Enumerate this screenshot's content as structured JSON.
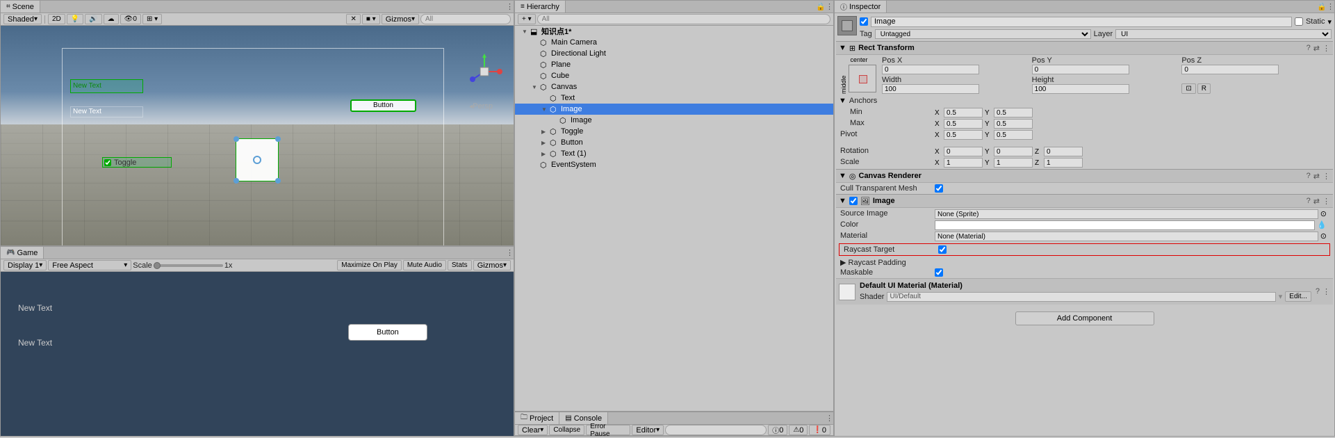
{
  "scene": {
    "tab": "Scene",
    "shading": "Shaded",
    "mode2d": "2D",
    "gizmos": "Gizmos",
    "search_placeholder": "All",
    "persp": "Persp",
    "objects": {
      "new_text1": "New Text",
      "new_text2": "New Text",
      "button": "Button",
      "toggle": "Toggle"
    }
  },
  "game": {
    "tab": "Game",
    "display": "Display 1",
    "aspect": "Free Aspect",
    "scale_label": "Scale",
    "scale_value": "1x",
    "maximize": "Maximize On Play",
    "mute": "Mute Audio",
    "stats": "Stats",
    "gizmos": "Gizmos",
    "new_text1": "New Text",
    "new_text2": "New Text",
    "button": "Button"
  },
  "hierarchy": {
    "tab": "Hierarchy",
    "search_placeholder": "All",
    "items": [
      {
        "depth": 0,
        "arrow": "▼",
        "icon": "⬓",
        "label": "知识点1*",
        "bold": true
      },
      {
        "depth": 1,
        "arrow": "",
        "icon": "⬡",
        "label": "Main Camera"
      },
      {
        "depth": 1,
        "arrow": "",
        "icon": "⬡",
        "label": "Directional Light"
      },
      {
        "depth": 1,
        "arrow": "",
        "icon": "⬡",
        "label": "Plane"
      },
      {
        "depth": 1,
        "arrow": "",
        "icon": "⬡",
        "label": "Cube"
      },
      {
        "depth": 1,
        "arrow": "▼",
        "icon": "⬡",
        "label": "Canvas"
      },
      {
        "depth": 2,
        "arrow": "",
        "icon": "⬡",
        "label": "Text"
      },
      {
        "depth": 2,
        "arrow": "▼",
        "icon": "⬡",
        "label": "Image",
        "selected": true
      },
      {
        "depth": 3,
        "arrow": "",
        "icon": "⬡",
        "label": "Image"
      },
      {
        "depth": 2,
        "arrow": "▶",
        "icon": "⬡",
        "label": "Toggle"
      },
      {
        "depth": 2,
        "arrow": "▶",
        "icon": "⬡",
        "label": "Button"
      },
      {
        "depth": 2,
        "arrow": "▶",
        "icon": "⬡",
        "label": "Text (1)"
      },
      {
        "depth": 1,
        "arrow": "",
        "icon": "⬡",
        "label": "EventSystem"
      }
    ]
  },
  "project": {
    "tab": "Project"
  },
  "console": {
    "tab": "Console",
    "clear": "Clear",
    "collapse": "Collapse",
    "error_pause": "Error Pause",
    "editor": "Editor",
    "count_info": "0",
    "count_warn": "0",
    "count_error": "0"
  },
  "inspector": {
    "tab": "Inspector",
    "name": "Image",
    "static": "Static",
    "tag_label": "Tag",
    "tag_value": "Untagged",
    "layer_label": "Layer",
    "layer_value": "UI",
    "rect": {
      "title": "Rect Transform",
      "anchor_preset": "center",
      "anchor_middle": "middle",
      "posx_label": "Pos X",
      "posx": "0",
      "posy_label": "Pos Y",
      "posy": "0",
      "posz_label": "Pos Z",
      "posz": "0",
      "width_label": "Width",
      "width": "100",
      "height_label": "Height",
      "height": "100",
      "r_btn": "R",
      "anchors_label": "Anchors",
      "min_label": "Min",
      "min_x": "0.5",
      "min_y": "0.5",
      "max_label": "Max",
      "max_x": "0.5",
      "max_y": "0.5",
      "pivot_label": "Pivot",
      "pivot_x": "0.5",
      "pivot_y": "0.5",
      "rotation_label": "Rotation",
      "rot_x": "0",
      "rot_y": "0",
      "rot_z": "0",
      "scale_label": "Scale",
      "scale_x": "1",
      "scale_y": "1",
      "scale_z": "1"
    },
    "canvas_renderer": {
      "title": "Canvas Renderer",
      "cull_label": "Cull Transparent Mesh"
    },
    "image": {
      "title": "Image",
      "source_label": "Source Image",
      "source_value": "None (Sprite)",
      "color_label": "Color",
      "material_label": "Material",
      "material_value": "None (Material)",
      "raycast_label": "Raycast Target",
      "raycast_padding_label": "Raycast Padding",
      "maskable_label": "Maskable"
    },
    "material": {
      "title": "Default UI Material (Material)",
      "shader_label": "Shader",
      "shader_value": "UI/Default",
      "edit": "Edit..."
    },
    "add_component": "Add Component"
  }
}
